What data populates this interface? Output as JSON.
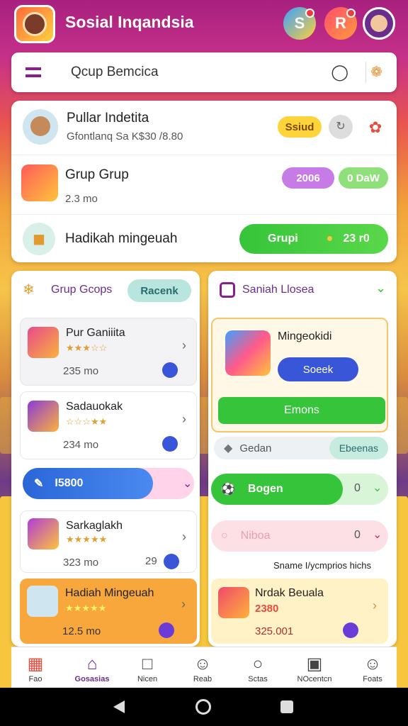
{
  "app": {
    "title": "Sosial Inqandsia"
  },
  "search": {
    "text": "Qcup Bemcica"
  },
  "header_card": {
    "profile": {
      "name": "Pullar Indetita",
      "subtitle": "Gfontlanq Sa K$30 /8.80",
      "badge": "Ssiud"
    },
    "group": {
      "name": "Grup Grup",
      "subtitle": "2.3 mo",
      "pill1": "2006",
      "pill2": "0 DaW"
    },
    "gift": {
      "label": "Hadikah mingeuah",
      "button_label": "Grupi",
      "button_value": "23 r0"
    }
  },
  "left": {
    "header": {
      "title": "Grup Gcops",
      "pill": "Racenk"
    },
    "items": [
      {
        "title": "Pur Ganiiita",
        "meta": "235 mo"
      },
      {
        "title": "Sadauokak",
        "meta": "234 mo"
      },
      {
        "title": "Sarkaglakh",
        "meta": "323 mo",
        "badge": "29"
      },
      {
        "title": "Hadiah Mingeuah",
        "meta": "12.5 mo"
      }
    ],
    "blue_pill": {
      "label": "I5800"
    }
  },
  "right": {
    "header": {
      "title": "Saniah Llosea"
    },
    "gift_card": {
      "title": "Mingeokidi",
      "secondary_button": "Soeek",
      "primary_button": "Emons"
    },
    "gedan": {
      "label": "Gedan",
      "pill": "Ebeenas"
    },
    "green_row": {
      "label": "Bogen",
      "count": "0"
    },
    "pink_row": {
      "label": "Niboa",
      "count": "0"
    },
    "caption": "Sname I/ycmprios hichs",
    "promo": {
      "title": "Nrdak Beuala",
      "value": "2380",
      "price": "325.001"
    }
  },
  "bottom_nav": [
    "Fao",
    "Gosasias",
    "Nicen",
    "Reab",
    "Sctas",
    "NOcentcn",
    "Foats"
  ],
  "colors": {
    "purple": "#8a1e8f",
    "green": "#34c434",
    "blue": "#3a56d8",
    "orange": "#f7a73b"
  },
  "icons": [
    "gift-icon",
    "home-icon",
    "chat-icon",
    "smile-icon",
    "person-icon",
    "tv-icon",
    "profile-icon"
  ]
}
